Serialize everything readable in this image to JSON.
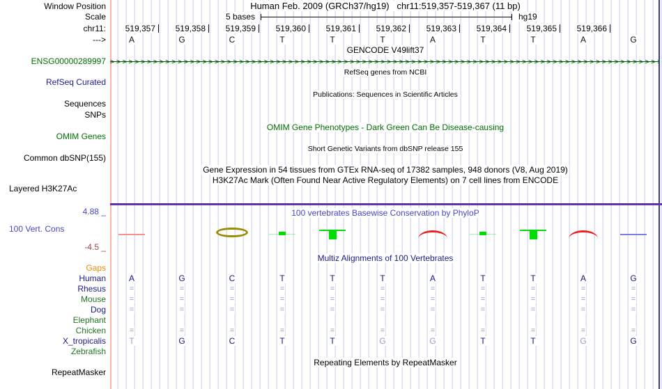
{
  "header": {
    "title": "Human Feb. 2009 (GRCh37/hg19)   chr11:519,357-519,367 (11 bp)",
    "window_position_label": "Window Position",
    "scale_label": "Scale",
    "scale_value": "5 bases",
    "assembly": "hg19",
    "chrom_label": "chr11:",
    "strand_arrow": "--->"
  },
  "ruler": {
    "positions": [
      "519,357",
      "519,358",
      "519,359",
      "519,360",
      "519,361",
      "519,362",
      "519,363",
      "519,364",
      "519,365",
      "519,366"
    ],
    "bases": [
      "A",
      "G",
      "C",
      "T",
      "T",
      "T",
      "A",
      "T",
      "T",
      "A",
      "G"
    ]
  },
  "colors": {
    "separator_purple": "#5c35aa",
    "gridline": "#dbdbf2",
    "gene_green": "#007200",
    "species_navy": "#17177d",
    "species_green": "#207520",
    "gaps_orange": "#ef8908",
    "conservation_blue": "#4646c8",
    "scale_min_maroon": "#9c4444"
  },
  "tracks": {
    "gencode": {
      "title": "GENCODE V49lift37",
      "gene_id": "ENSG00000289997",
      "strand_arrows": ">>>>>>>>>>>>>>>>>>>>>>>>>>>>>>>>>>>>>>>>>>>>>>>>>>>>>>>>>>>>>>>>>>>>>>>>>>>>>>>>>>>>>>>>>>>>>>>>>>>>"
    },
    "refseq": {
      "title": "RefSeq genes from NCBI",
      "label": "RefSeq Curated"
    },
    "publications": {
      "title": "Publications: Sequences in Scientific Articles",
      "sequences_label": "Sequences",
      "snps_label": "SNPs"
    },
    "omim": {
      "title": "OMIM Gene Phenotypes - Dark Green Can Be Disease-causing",
      "label": "OMIM Genes"
    },
    "dbsnp": {
      "title": "Short Genetic Variants from dbSNP release 155",
      "label": "Common dbSNP(155)"
    },
    "gtex": {
      "title": "Gene Expression in 54 tissues from GTEx RNA-seq of 17382 samples, 948 donors (V8, Aug 2019)"
    },
    "h3k27ac": {
      "title": "H3K27Ac Mark (Often Found Near Active Regulatory Elements) on 7 cell lines from ENCODE",
      "label": "Layered H3K27Ac"
    },
    "phylop": {
      "title": "100 vertebrates Basewise Conservation by PhyloP",
      "label": "100 Vert. Cons",
      "scale_max": "4.88 _",
      "scale_min": "-4.5 _",
      "marks": [
        {
          "col": 0,
          "type": "flatline",
          "color": "#f2938f"
        },
        {
          "col": 2,
          "type": "ellipse",
          "color": "#9b8b00"
        },
        {
          "col": 3,
          "type": "smallbar",
          "color": "#00dd00"
        },
        {
          "col": 4,
          "type": "negbar",
          "color": "#00dd00"
        },
        {
          "col": 6,
          "type": "arc",
          "color": "#e82020"
        },
        {
          "col": 7,
          "type": "smallbar",
          "color": "#00dd00"
        },
        {
          "col": 8,
          "type": "negbar",
          "color": "#00dd00"
        },
        {
          "col": 9,
          "type": "arc",
          "color": "#e82020"
        },
        {
          "col": 10,
          "type": "flatline",
          "color": "#7d7de0"
        }
      ]
    },
    "multiz": {
      "title": "Multiz Alignments of 100 Vertebrates",
      "rows": [
        {
          "label": "Gaps",
          "color": "orange",
          "cells": [
            "",
            "",
            "",
            "",
            "",
            "",
            "",
            "",
            "",
            "",
            ""
          ]
        },
        {
          "label": "Human",
          "color": "navy",
          "cells": [
            "A",
            "G",
            "C",
            "T",
            "T",
            "T",
            "A",
            "T",
            "T",
            "A",
            "G"
          ]
        },
        {
          "label": "Rhesus",
          "color": "navy",
          "cells": [
            "=",
            "=",
            "=",
            "=",
            "=",
            "=",
            "=",
            "=",
            "=",
            "=",
            "="
          ]
        },
        {
          "label": "Mouse",
          "color": "green",
          "cells": [
            "=",
            "=",
            "=",
            "=",
            "=",
            "=",
            "=",
            "=",
            "=",
            "=",
            "="
          ]
        },
        {
          "label": "Dog",
          "color": "navy",
          "cells": [
            "=",
            "=",
            "=",
            "=",
            "=",
            "=",
            "=",
            "=",
            "=",
            "=",
            "="
          ]
        },
        {
          "label": "Elephant",
          "color": "green",
          "cells": [
            "",
            "",
            "",
            "",
            "",
            "",
            "",
            "",
            "",
            "",
            ""
          ]
        },
        {
          "label": "Chicken",
          "color": "green",
          "cells": [
            "=",
            "=",
            "=",
            "=",
            "=",
            "=",
            "=",
            "=",
            "=",
            "=",
            "="
          ]
        },
        {
          "label": "X_tropicalis",
          "color": "navy",
          "cells": [
            "T",
            "G",
            "C",
            "T",
            "T",
            "G",
            "G",
            "T",
            "T",
            "G",
            "G"
          ],
          "dim": [
            true,
            false,
            false,
            false,
            false,
            true,
            true,
            false,
            false,
            true,
            false
          ]
        },
        {
          "label": "Zebrafish",
          "color": "green",
          "cells": [
            "",
            "",
            "",
            "",
            "",
            "",
            "",
            "",
            "",
            "",
            ""
          ]
        }
      ]
    },
    "repeatmasker": {
      "title": "Repeating Elements by RepeatMasker",
      "label": "RepeatMasker"
    }
  }
}
